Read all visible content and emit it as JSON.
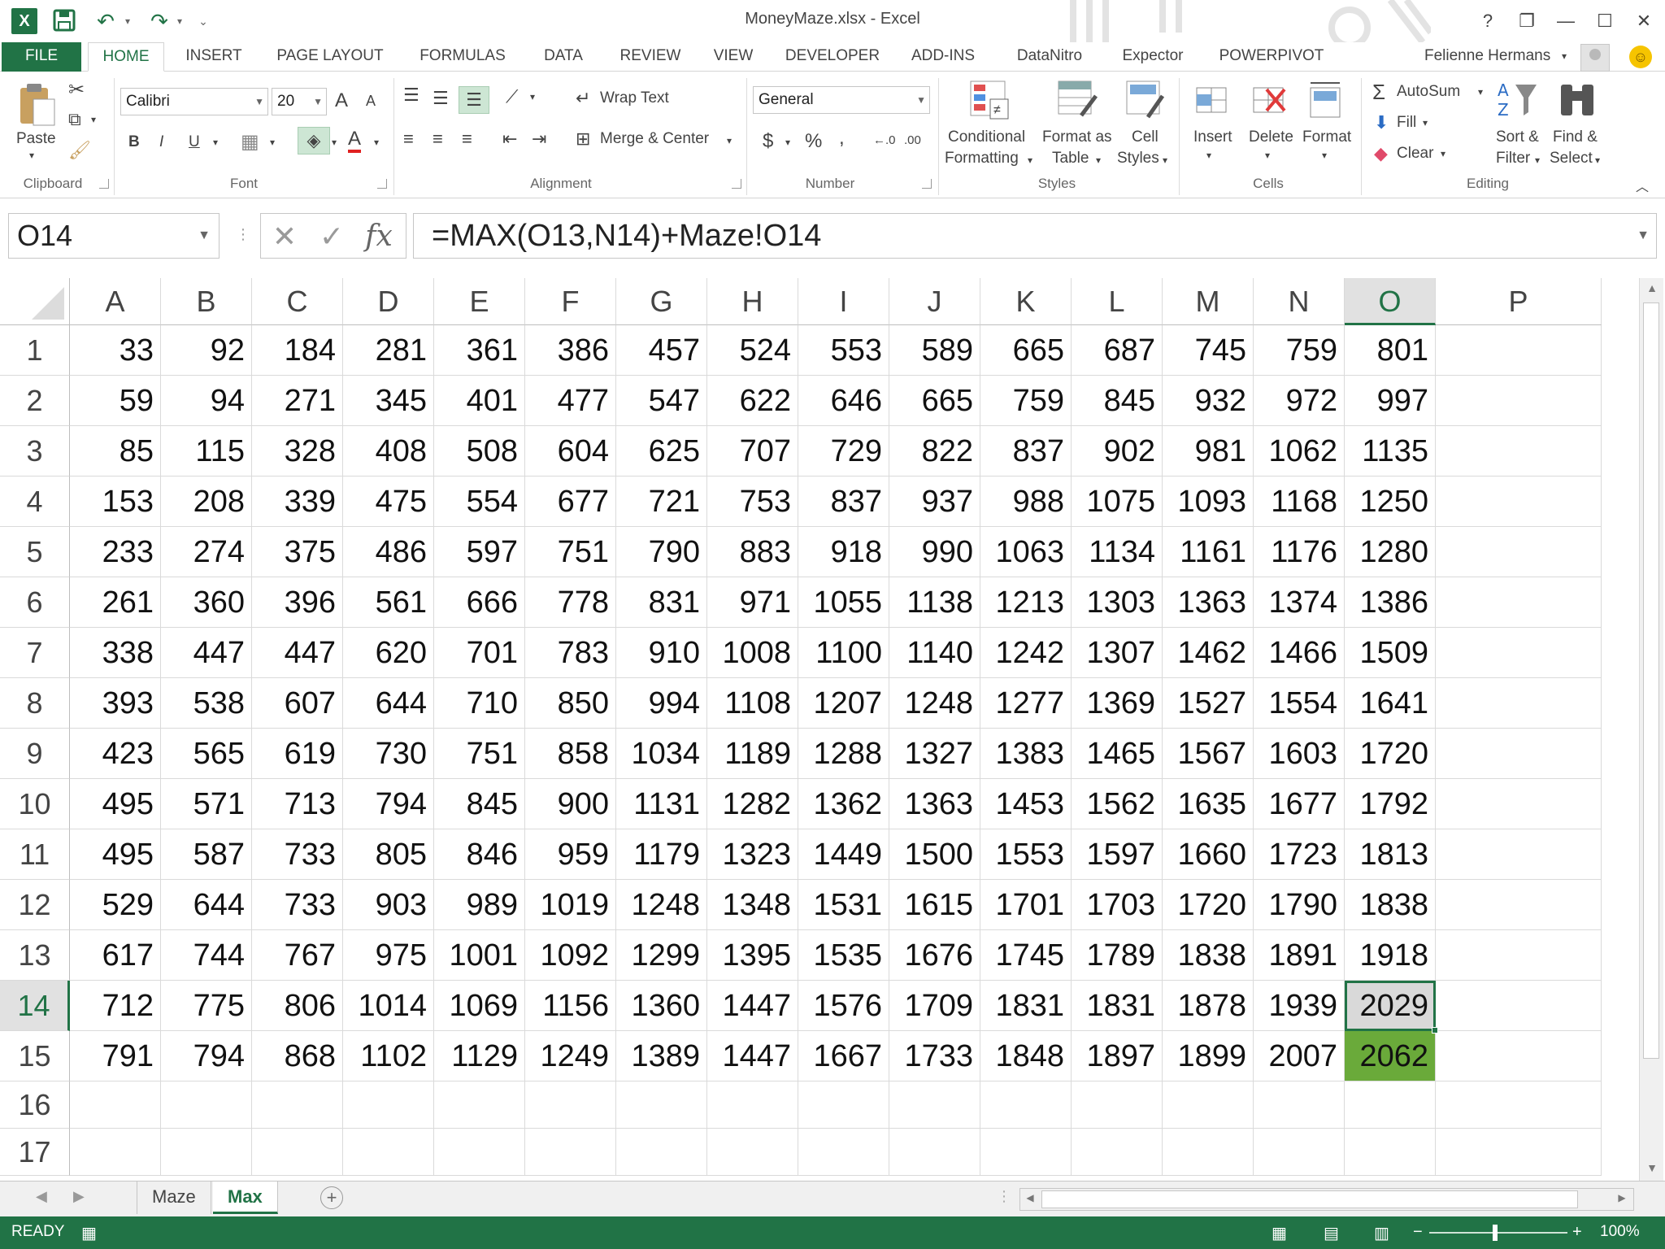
{
  "window": {
    "title": "MoneyMaze.xlsx - Excel",
    "help": "?",
    "restore": "❐",
    "minimize": "—",
    "maximize": "☐",
    "close": "✕"
  },
  "quick_access": {
    "save_icon": "save-icon",
    "undo_icon": "undo-icon",
    "redo_icon": "redo-icon",
    "customize_icon": "customize-icon"
  },
  "tabs": [
    "FILE",
    "HOME",
    "INSERT",
    "PAGE LAYOUT",
    "FORMULAS",
    "DATA",
    "REVIEW",
    "VIEW",
    "DEVELOPER",
    "ADD-INS",
    "DataNitro",
    "Expector",
    "POWERPIVOT"
  ],
  "active_tab": "HOME",
  "user": {
    "name": "Felienne Hermans"
  },
  "ribbon": {
    "clipboard": {
      "label": "Clipboard",
      "paste": "Paste"
    },
    "font": {
      "label": "Font",
      "name": "Calibri",
      "size": "20",
      "bold": "B",
      "italic": "I",
      "underline": "U",
      "grow": "A",
      "shrink": "A",
      "font_color_letter": "A"
    },
    "alignment": {
      "label": "Alignment",
      "wrap_text": "Wrap Text",
      "merge_center": "Merge & Center"
    },
    "number": {
      "label": "Number",
      "format": "General",
      "currency": "$",
      "percent": "%",
      "comma": ",",
      "inc_decimal": "←.0",
      "dec_decimal": ".00"
    },
    "styles": {
      "label": "Styles",
      "conditional_1": "Conditional",
      "conditional_2": "Formatting",
      "format_as_1": "Format as",
      "format_as_2": "Table",
      "cell_styles_1": "Cell",
      "cell_styles_2": "Styles"
    },
    "cells": {
      "label": "Cells",
      "insert": "Insert",
      "delete": "Delete",
      "format": "Format"
    },
    "editing": {
      "label": "Editing",
      "autosum": "AutoSum",
      "fill": "Fill",
      "clear": "Clear",
      "sort_1": "Sort &",
      "sort_2": "Filter",
      "find_1": "Find &",
      "find_2": "Select"
    }
  },
  "formula_bar": {
    "name_box": "O14",
    "cancel": "✕",
    "enter": "✓",
    "fx": "fx",
    "formula": "=MAX(O13,N14)+Maze!O14"
  },
  "grid": {
    "columns": [
      "A",
      "B",
      "C",
      "D",
      "E",
      "F",
      "G",
      "H",
      "I",
      "J",
      "K",
      "L",
      "M",
      "N",
      "O",
      "P"
    ],
    "selected_column": "O",
    "selected_row": "14",
    "active_cell": "O14",
    "highlighted_cell": "O15",
    "highlight_color": "#6aaa3a",
    "rows": [
      {
        "n": "1",
        "v": [
          "33",
          "92",
          "184",
          "281",
          "361",
          "386",
          "457",
          "524",
          "553",
          "589",
          "665",
          "687",
          "745",
          "759",
          "801",
          ""
        ]
      },
      {
        "n": "2",
        "v": [
          "59",
          "94",
          "271",
          "345",
          "401",
          "477",
          "547",
          "622",
          "646",
          "665",
          "759",
          "845",
          "932",
          "972",
          "997",
          ""
        ]
      },
      {
        "n": "3",
        "v": [
          "85",
          "115",
          "328",
          "408",
          "508",
          "604",
          "625",
          "707",
          "729",
          "822",
          "837",
          "902",
          "981",
          "1062",
          "1135",
          ""
        ]
      },
      {
        "n": "4",
        "v": [
          "153",
          "208",
          "339",
          "475",
          "554",
          "677",
          "721",
          "753",
          "837",
          "937",
          "988",
          "1075",
          "1093",
          "1168",
          "1250",
          ""
        ]
      },
      {
        "n": "5",
        "v": [
          "233",
          "274",
          "375",
          "486",
          "597",
          "751",
          "790",
          "883",
          "918",
          "990",
          "1063",
          "1134",
          "1161",
          "1176",
          "1280",
          ""
        ]
      },
      {
        "n": "6",
        "v": [
          "261",
          "360",
          "396",
          "561",
          "666",
          "778",
          "831",
          "971",
          "1055",
          "1138",
          "1213",
          "1303",
          "1363",
          "1374",
          "1386",
          ""
        ]
      },
      {
        "n": "7",
        "v": [
          "338",
          "447",
          "447",
          "620",
          "701",
          "783",
          "910",
          "1008",
          "1100",
          "1140",
          "1242",
          "1307",
          "1462",
          "1466",
          "1509",
          ""
        ]
      },
      {
        "n": "8",
        "v": [
          "393",
          "538",
          "607",
          "644",
          "710",
          "850",
          "994",
          "1108",
          "1207",
          "1248",
          "1277",
          "1369",
          "1527",
          "1554",
          "1641",
          ""
        ]
      },
      {
        "n": "9",
        "v": [
          "423",
          "565",
          "619",
          "730",
          "751",
          "858",
          "1034",
          "1189",
          "1288",
          "1327",
          "1383",
          "1465",
          "1567",
          "1603",
          "1720",
          ""
        ]
      },
      {
        "n": "10",
        "v": [
          "495",
          "571",
          "713",
          "794",
          "845",
          "900",
          "1131",
          "1282",
          "1362",
          "1363",
          "1453",
          "1562",
          "1635",
          "1677",
          "1792",
          ""
        ]
      },
      {
        "n": "11",
        "v": [
          "495",
          "587",
          "733",
          "805",
          "846",
          "959",
          "1179",
          "1323",
          "1449",
          "1500",
          "1553",
          "1597",
          "1660",
          "1723",
          "1813",
          ""
        ]
      },
      {
        "n": "12",
        "v": [
          "529",
          "644",
          "733",
          "903",
          "989",
          "1019",
          "1248",
          "1348",
          "1531",
          "1615",
          "1701",
          "1703",
          "1720",
          "1790",
          "1838",
          ""
        ]
      },
      {
        "n": "13",
        "v": [
          "617",
          "744",
          "767",
          "975",
          "1001",
          "1092",
          "1299",
          "1395",
          "1535",
          "1676",
          "1745",
          "1789",
          "1838",
          "1891",
          "1918",
          ""
        ]
      },
      {
        "n": "14",
        "v": [
          "712",
          "775",
          "806",
          "1014",
          "1069",
          "1156",
          "1360",
          "1447",
          "1576",
          "1709",
          "1831",
          "1831",
          "1878",
          "1939",
          "2029",
          ""
        ]
      },
      {
        "n": "15",
        "v": [
          "791",
          "794",
          "868",
          "1102",
          "1129",
          "1249",
          "1389",
          "1447",
          "1667",
          "1733",
          "1848",
          "1897",
          "1899",
          "2007",
          "2062",
          ""
        ]
      },
      {
        "n": "16",
        "v": [
          "",
          "",
          "",
          "",
          "",
          "",
          "",
          "",
          "",
          "",
          "",
          "",
          "",
          "",
          "",
          ""
        ]
      },
      {
        "n": "17",
        "v": [
          "",
          "",
          "",
          "",
          "",
          "",
          "",
          "",
          "",
          "",
          "",
          "",
          "",
          "",
          "",
          ""
        ]
      }
    ]
  },
  "sheets": [
    "Maze",
    "Max"
  ],
  "active_sheet": "Max",
  "status": {
    "ready": "READY",
    "zoom": "100%",
    "zoom_minus": "−",
    "zoom_plus": "+"
  },
  "colors": {
    "accent": "#217346",
    "highlight": "#6aaa3a"
  }
}
